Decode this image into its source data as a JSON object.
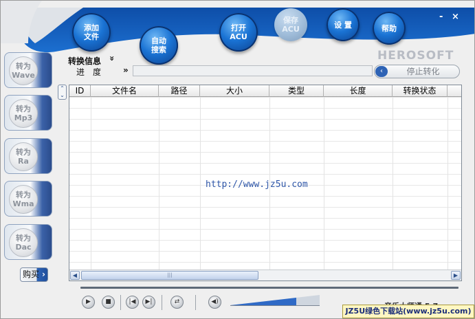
{
  "toolbar": {
    "add_file": "添加\n文件",
    "auto_search": "自动\n搜索",
    "open_acu": "打开\nACU",
    "save_acu": "保存\nACU",
    "settings": "设 置",
    "help": "帮助"
  },
  "window": {
    "minimize": "-",
    "close": "×"
  },
  "brand": "HEROSOFT",
  "side_buttons": [
    {
      "label": "转为\nWave"
    },
    {
      "label": "转为\nMp3"
    },
    {
      "label": "转为\nRa"
    },
    {
      "label": "转为\nWma"
    },
    {
      "label": "转为\nDac"
    }
  ],
  "info": {
    "convert_info_label": "转换信息",
    "convert_info_toggle": "»",
    "progress_label": "进　度",
    "progress_arrow": "»",
    "progress_value": 0
  },
  "stop_button": "停止转化",
  "stop_arrow": "‹",
  "table": {
    "columns": [
      "ID",
      "文件名",
      "路径",
      "大小",
      "类型",
      "长度",
      "转换状态"
    ],
    "rows": []
  },
  "watermark": "http://www.jz5u.com",
  "buy": "购买",
  "buy_arrow": "›",
  "player": {
    "play": "▶",
    "stop": "■",
    "prev": "|◀",
    "next": "▶|",
    "repeat": "⇄",
    "mute": "◀)"
  },
  "footer_badge": "JZ5U绿色下载站(www.jz5u.com)",
  "under_badge": "音乐大师通 5.7"
}
